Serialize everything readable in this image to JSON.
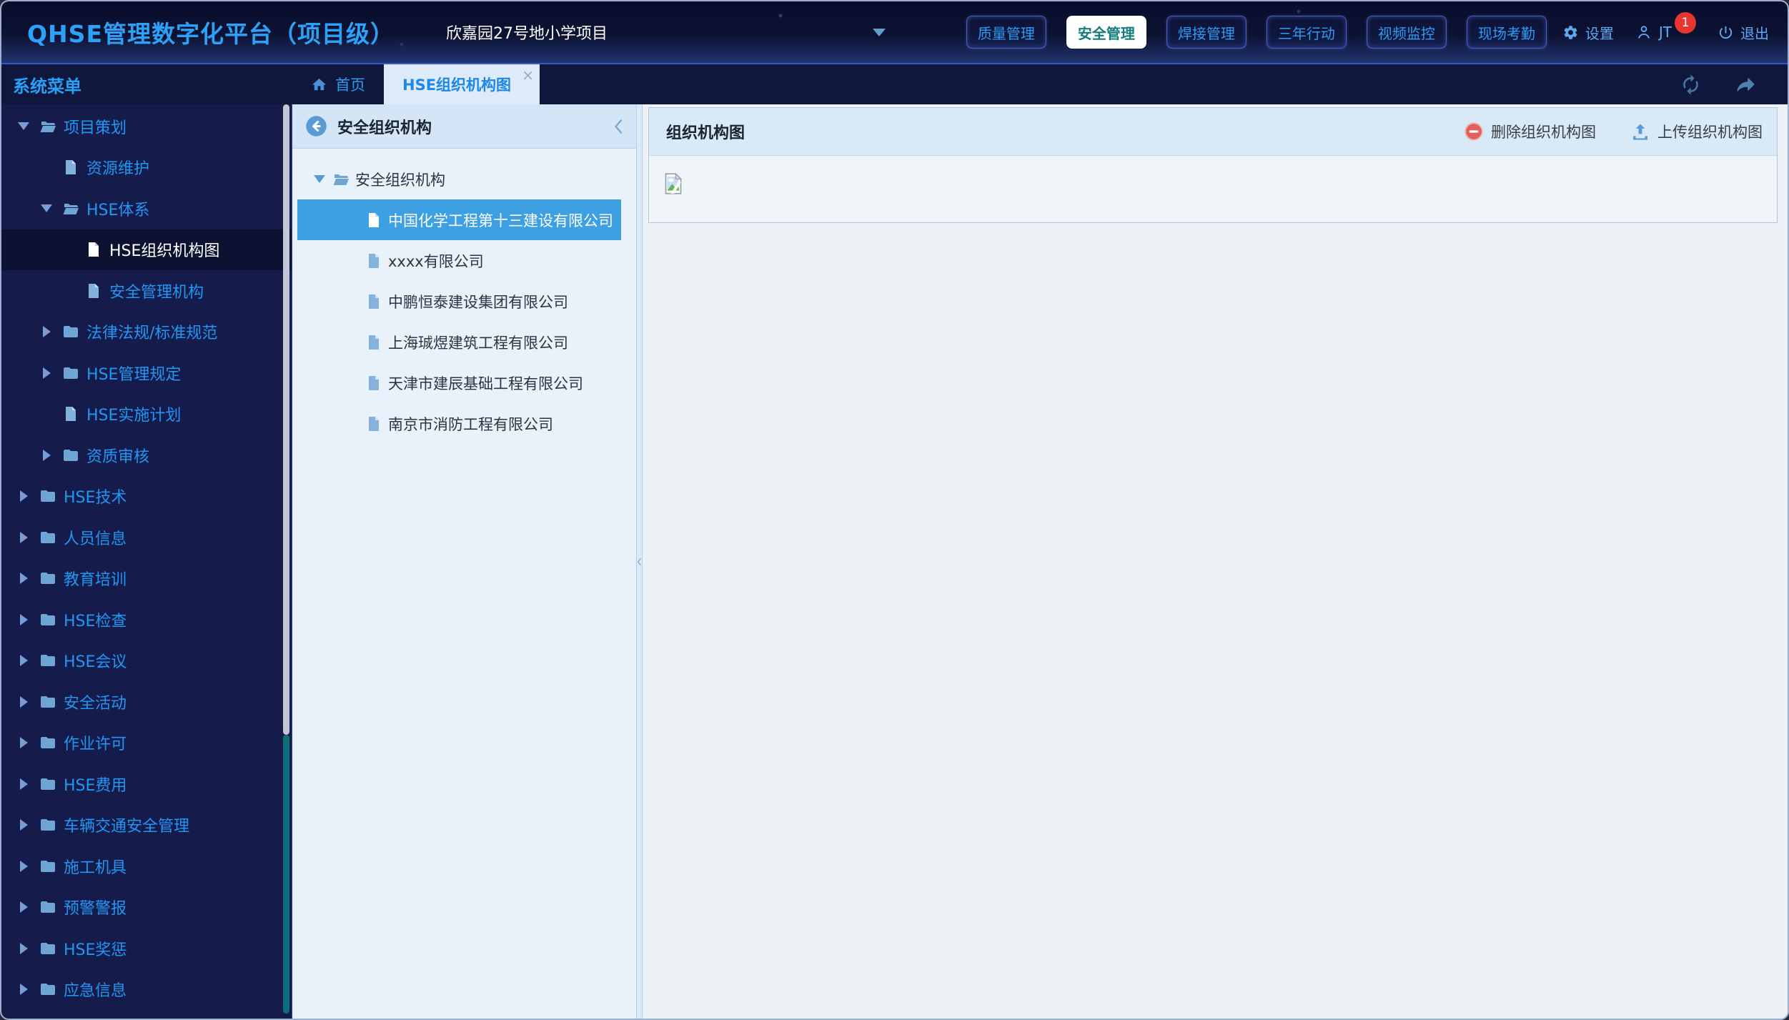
{
  "header": {
    "app_title": "QHSE管理数字化平台（项目级）",
    "project_name": "欣嘉园27号地小学项目",
    "project_dropdown_icon": "chevron-down-icon",
    "nav_buttons": [
      {
        "label": "质量管理",
        "active": false
      },
      {
        "label": "安全管理",
        "active": true
      },
      {
        "label": "焊接管理",
        "active": false
      },
      {
        "label": "三年行动",
        "active": false
      },
      {
        "label": "视频监控",
        "active": false
      },
      {
        "label": "现场考勤",
        "active": false
      }
    ],
    "settings_icon": "gear-icon",
    "settings_label": "设置",
    "user_icon": "person-icon",
    "user_label": "JT",
    "notification_count": "1",
    "logout_icon": "power-icon",
    "logout_label": "退出"
  },
  "tabbar": {
    "home_icon": "home-icon",
    "home_label": "首页",
    "active_tab_label": "HSE组织机构图",
    "close_icon_glyph": "×",
    "refresh_icon": "refresh-icon",
    "forward_icon": "forward-arrow-icon"
  },
  "sidebar": {
    "title": "系统菜单",
    "items": [
      {
        "label": "项目策划",
        "type": "folder-open",
        "level": 1,
        "expanded": true
      },
      {
        "label": "资源维护",
        "type": "file",
        "level": 2
      },
      {
        "label": "HSE体系",
        "type": "folder-open",
        "level": 2,
        "expanded": true
      },
      {
        "label": "HSE组织机构图",
        "type": "file",
        "level": 3,
        "active": true
      },
      {
        "label": "安全管理机构",
        "type": "file",
        "level": 3
      },
      {
        "label": "法律法规/标准规范",
        "type": "folder",
        "level": 2
      },
      {
        "label": "HSE管理规定",
        "type": "folder",
        "level": 2
      },
      {
        "label": "HSE实施计划",
        "type": "file",
        "level": 2
      },
      {
        "label": "资质审核",
        "type": "folder",
        "level": 2
      },
      {
        "label": "HSE技术",
        "type": "folder",
        "level": 1
      },
      {
        "label": "人员信息",
        "type": "folder",
        "level": 1
      },
      {
        "label": "教育培训",
        "type": "folder",
        "level": 1
      },
      {
        "label": "HSE检查",
        "type": "folder",
        "level": 1
      },
      {
        "label": "HSE会议",
        "type": "folder",
        "level": 1
      },
      {
        "label": "安全活动",
        "type": "folder",
        "level": 1
      },
      {
        "label": "作业许可",
        "type": "folder",
        "level": 1
      },
      {
        "label": "HSE费用",
        "type": "folder",
        "level": 1
      },
      {
        "label": "车辆交通安全管理",
        "type": "folder",
        "level": 1
      },
      {
        "label": "施工机具",
        "type": "folder",
        "level": 1
      },
      {
        "label": "预警警报",
        "type": "folder",
        "level": 1
      },
      {
        "label": "HSE奖惩",
        "type": "folder",
        "level": 1
      },
      {
        "label": "应急信息",
        "type": "folder",
        "level": 1
      }
    ]
  },
  "org_panel": {
    "back_icon": "back-circle-icon",
    "title": "安全组织机构",
    "collapse_icon": "chevron-left-icon",
    "tree": [
      {
        "label": "安全组织机构",
        "type": "folder-open",
        "level": 1,
        "expanded": true
      },
      {
        "label": "中国化学工程第十三建设有限公司",
        "type": "file",
        "level": 2,
        "active": true
      },
      {
        "label": "xxxx有限公司",
        "type": "file",
        "level": 2
      },
      {
        "label": "中鹏恒泰建设集团有限公司",
        "type": "file",
        "level": 2
      },
      {
        "label": "上海珹煜建筑工程有限公司",
        "type": "file",
        "level": 2
      },
      {
        "label": "天津市建辰基础工程有限公司",
        "type": "file",
        "level": 2
      },
      {
        "label": "南京市消防工程有限公司",
        "type": "file",
        "level": 2
      }
    ]
  },
  "chart_panel": {
    "title": "组织机构图",
    "delete_icon": "minus-circle-icon",
    "delete_label": "删除组织机构图",
    "upload_icon": "upload-icon",
    "upload_label": "上传组织机构图",
    "body_placeholder_icon": "broken-image-icon"
  },
  "colors": {
    "accent_blue": "#2196f3",
    "selected_row": "#3da0e3",
    "active_nav_text": "#157c7c",
    "badge_red": "#e8352e",
    "scrollbar_teal": "#0e6e78",
    "sidebar_bg": "#151c4b",
    "band_bg": "#10173d"
  }
}
